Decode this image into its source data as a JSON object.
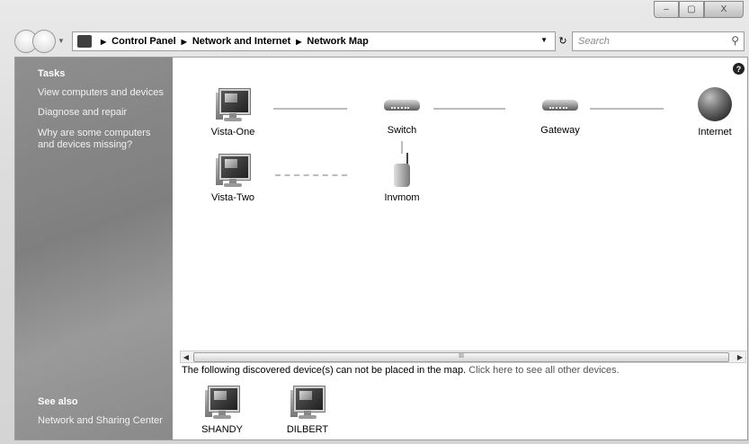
{
  "window": {
    "buttons": {
      "minimize": "–",
      "maximize": "▢",
      "close": "X"
    }
  },
  "nav": {
    "breadcrumbs": [
      "Control Panel",
      "Network and Internet",
      "Network Map"
    ],
    "search_placeholder": "Search",
    "refresh_glyph": "↻"
  },
  "sidebar": {
    "tasks_heading": "Tasks",
    "tasks": [
      "View computers and devices",
      "Diagnose and repair",
      "Why are some computers and devices missing?"
    ],
    "see_also_heading": "See also",
    "see_also": [
      "Network and Sharing Center"
    ]
  },
  "map": {
    "help_glyph": "?",
    "nodes": {
      "vista_one": "Vista-One",
      "switch": "Switch",
      "gateway": "Gateway",
      "internet": "Internet",
      "vista_two": "Vista-Two",
      "invmom": "Invmom"
    }
  },
  "scroll": {
    "thumb_grip": "III"
  },
  "unplaced": {
    "message": "The following discovered device(s) can not be placed in the map.",
    "link": "Click here to see all other devices.",
    "devices": [
      "SHANDY",
      "DILBERT"
    ]
  },
  "colors": {
    "sidebar": "#8a8a8a",
    "link_line": "#bcbcbc"
  },
  "icons": [
    "back-icon",
    "forward-icon",
    "control-panel-icon",
    "refresh-icon",
    "search-icon",
    "help-icon",
    "computer-icon",
    "switch-icon",
    "gateway-icon",
    "globe-icon",
    "wireless-router-icon"
  ]
}
